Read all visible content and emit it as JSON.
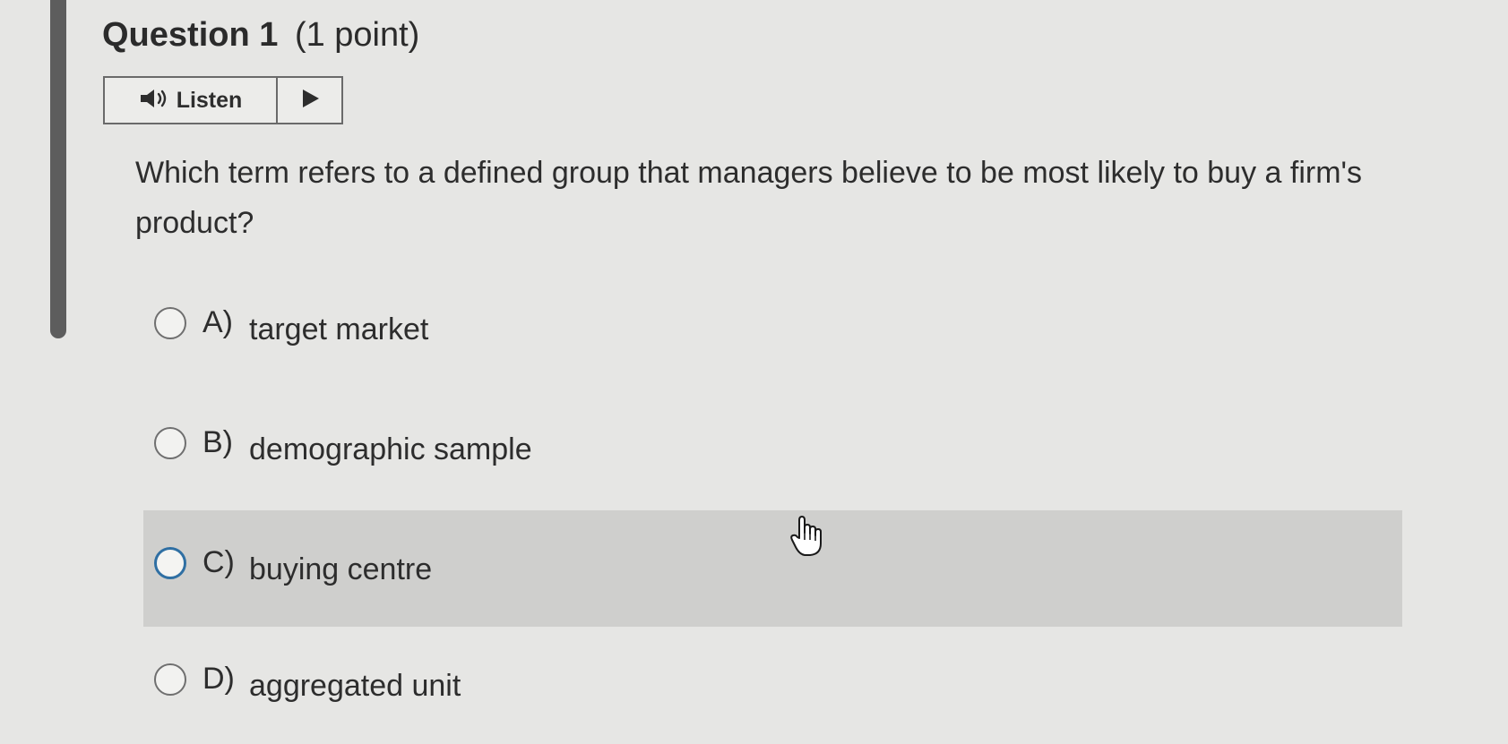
{
  "question": {
    "title": "Question 1",
    "points": "(1 point)"
  },
  "listen": {
    "label": "Listen",
    "speaker_icon": "speaker-icon",
    "play_icon": "play-icon"
  },
  "prompt": "Which term refers to a defined group that managers believe to be most likely to buy a firm's product?",
  "options": [
    {
      "letter": "A)",
      "text": "target market",
      "selected": false
    },
    {
      "letter": "B)",
      "text": "demographic sample",
      "selected": false
    },
    {
      "letter": "C)",
      "text": "buying centre",
      "selected": false,
      "hovered": true
    },
    {
      "letter": "D)",
      "text": "aggregated unit",
      "selected": false
    }
  ],
  "colors": {
    "background": "#e6e6e4",
    "hover_row": "#cfcfcd",
    "radio_focus": "#2f6fa3",
    "text": "#2d2d2d"
  }
}
